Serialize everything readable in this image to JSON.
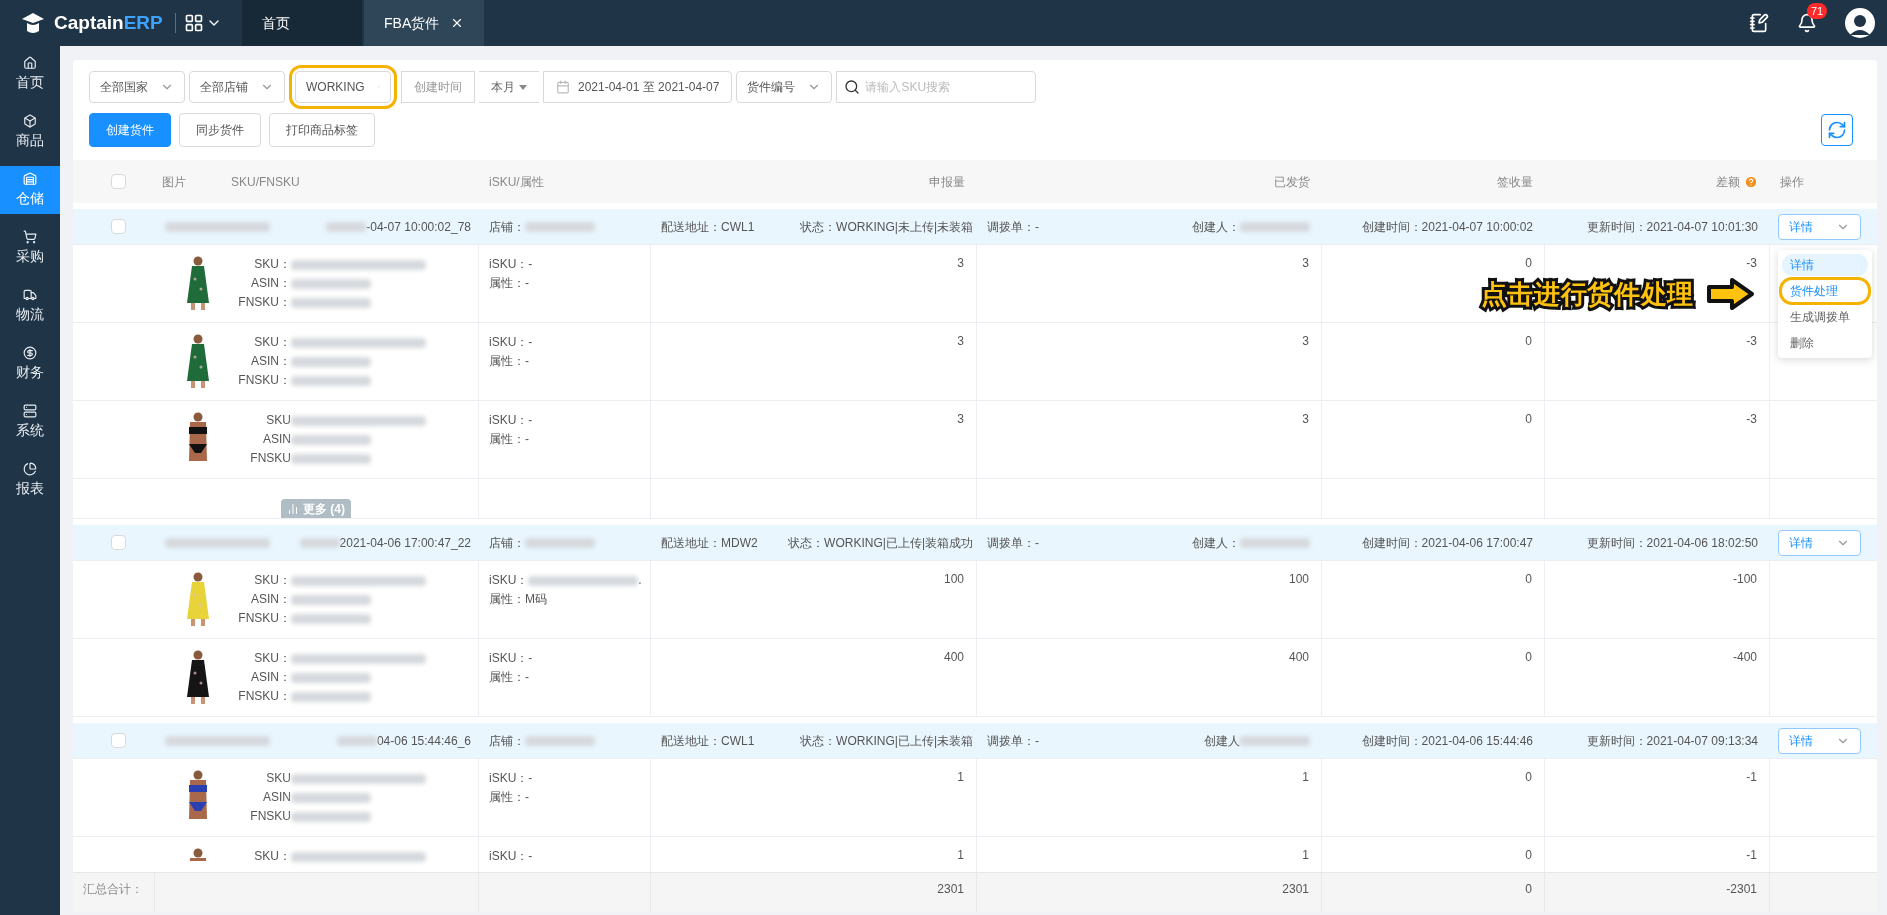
{
  "topbar": {
    "logo_main": "Captain",
    "logo_accent": "ERP",
    "notification_count": "71"
  },
  "tabs": [
    {
      "label": "首页",
      "selected": false,
      "closable": false
    },
    {
      "label": "FBA货件",
      "selected": true,
      "closable": true
    }
  ],
  "sidebar": {
    "items": [
      {
        "label": "首页",
        "selected": false
      },
      {
        "label": "商品",
        "selected": false
      },
      {
        "label": "仓储",
        "selected": true
      },
      {
        "label": "采购",
        "selected": false
      },
      {
        "label": "物流",
        "selected": false
      },
      {
        "label": "财务",
        "selected": false
      },
      {
        "label": "系统",
        "selected": false
      },
      {
        "label": "报表",
        "selected": false
      }
    ]
  },
  "filters": [
    {
      "kind": "select",
      "value": "全部国家",
      "highlighted": false
    },
    {
      "kind": "select",
      "value": "全部店铺",
      "highlighted": false
    },
    {
      "kind": "select",
      "value": "WORKING",
      "highlighted": true
    },
    {
      "kind": "label",
      "value": "创建时间"
    },
    {
      "kind": "dropdown",
      "value": "本月"
    },
    {
      "kind": "date",
      "value": "2021-04-01 至 2021-04-07"
    },
    {
      "kind": "select",
      "value": "货件编号",
      "highlighted": false
    },
    {
      "kind": "search",
      "placeholder": "请输入SKU搜索"
    }
  ],
  "actions": [
    {
      "label": "创建货件",
      "primary": true
    },
    {
      "label": "同步货件",
      "primary": false
    },
    {
      "label": "打印商品标签",
      "primary": false
    }
  ],
  "table": {
    "header_checked": false,
    "columns": [
      "图片",
      "SKU/FNSKU",
      "iSKU/属性",
      "申报量",
      "已发货",
      "签收量",
      "差额",
      "操作"
    ],
    "groups": [
      {
        "checked": false,
        "shipment_name": "-04-07 10:00:02_78",
        "store": "店铺：",
        "address": "配送地址：CWL1",
        "status": "状态：WORKING|未上传|未装箱",
        "transfer": "调拨单：-",
        "creator": "创建人：",
        "created": "创建时间：2021-04-07 10:00:02",
        "updated": "更新时间：2021-04-07 10:01:30",
        "action": "详情",
        "menu_open": true,
        "menu": [
          {
            "label": "详情",
            "selected": true,
            "highlighted": false
          },
          {
            "label": "货件处理",
            "selected": false,
            "highlighted": true
          },
          {
            "label": "生成调拨单",
            "selected": false,
            "highlighted": false
          },
          {
            "label": "删除",
            "selected": false,
            "highlighted": false
          }
        ],
        "callout": "点击进行货件处理",
        "rows": [
          {
            "sku": "SKU：",
            "asin": "ASIN：",
            "fnsku": "FNSKU：",
            "isku": "iSKU：-",
            "attr": "属性：-",
            "declared": "3",
            "shipped": "3",
            "received": "0",
            "difference": "-3"
          },
          {
            "sku": "SKU：",
            "asin": "ASIN：",
            "fnsku": "FNSKU：",
            "isku": "iSKU：-",
            "attr": "属性：-",
            "declared": "3",
            "shipped": "3",
            "received": "0",
            "difference": "-3"
          },
          {
            "sku": "SKU",
            "asin": "ASIN",
            "fnsku": "FNSKU",
            "isku": "iSKU：-",
            "attr": "属性：-",
            "declared": "3",
            "shipped": "3",
            "received": "0",
            "difference": "-3"
          }
        ],
        "more": "更多 (4)"
      },
      {
        "checked": false,
        "shipment_name": "2021-04-06 17:00:47_22",
        "store": "店铺：",
        "address": "配送地址：MDW2",
        "status": "状态：WORKING|已上传|装箱成功",
        "transfer": "调拨单：-",
        "creator": "创建人：",
        "created": "创建时间：2021-04-06 17:00:47",
        "updated": "更新时间：2021-04-06 18:02:50",
        "action": "详情",
        "menu_open": false,
        "rows": [
          {
            "sku": "SKU：",
            "asin": "ASIN：",
            "fnsku": "FNSKU：",
            "isku": "iSKU：",
            "isku_tail": ".",
            "attr": "属性：M码",
            "declared": "100",
            "shipped": "100",
            "received": "0",
            "difference": "-100"
          },
          {
            "sku": "SKU：",
            "asin": "ASIN：",
            "fnsku": "FNSKU：",
            "isku": "iSKU：-",
            "attr": "属性：-",
            "declared": "400",
            "shipped": "400",
            "received": "0",
            "difference": "-400"
          }
        ]
      },
      {
        "checked": false,
        "shipment_name": "04-06 15:44:46_6",
        "store": "店铺：",
        "address": "配送地址：CWL1",
        "status": "状态：WORKING|已上传|未装箱",
        "transfer": "调拨单：-",
        "creator": "创建人",
        "created": "创建时间：2021-04-06 15:44:46",
        "updated": "更新时间：2021-04-07 09:13:34",
        "action": "详情",
        "menu_open": false,
        "rows": [
          {
            "sku": "SKU",
            "asin": "ASIN",
            "fnsku": "FNSKU",
            "isku": "iSKU：-",
            "attr": "属性：-",
            "declared": "1",
            "shipped": "1",
            "received": "0",
            "difference": "-1"
          },
          {
            "sku": "SKU：",
            "isku": "iSKU：-",
            "declared": "1",
            "shipped": "1",
            "received": "0",
            "difference": "-1"
          }
        ]
      }
    ],
    "totals": {
      "label": "汇总合计：",
      "declared": "2301",
      "shipped": "2301",
      "received": "0",
      "difference": "-2301"
    }
  }
}
